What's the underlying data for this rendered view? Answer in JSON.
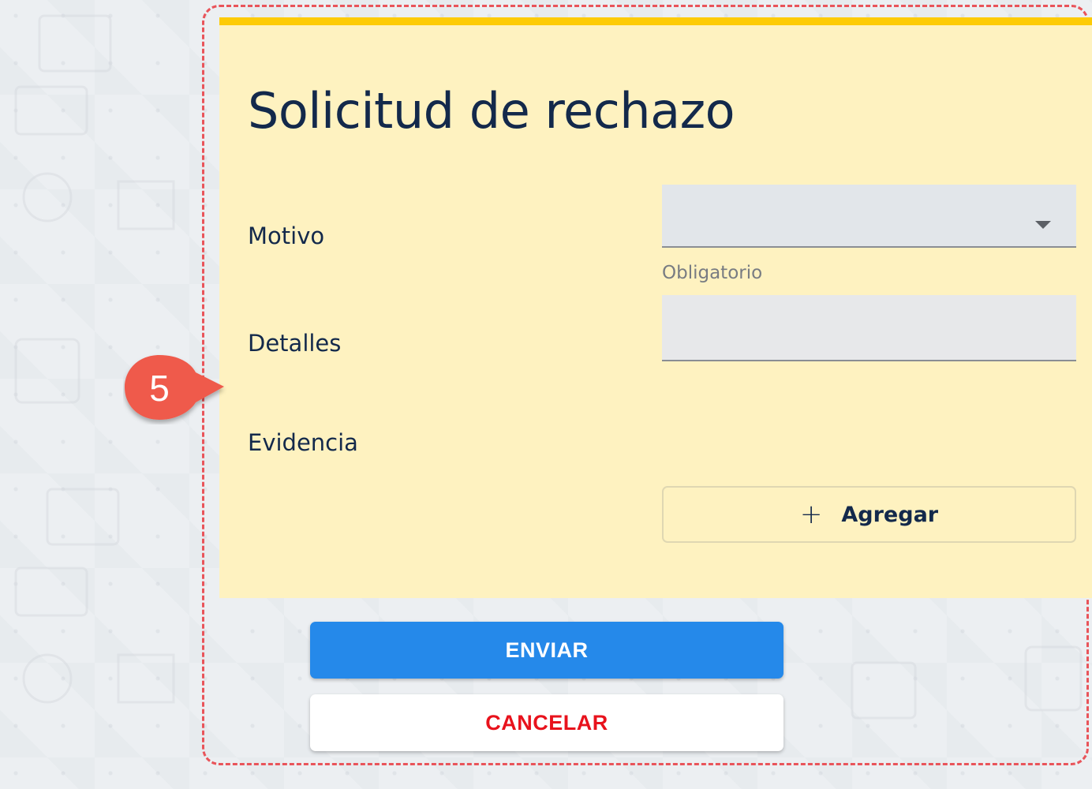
{
  "form": {
    "title": "Solicitud de rechazo",
    "fields": {
      "motivo": {
        "label": "Motivo",
        "value": "",
        "helper": "Obligatorio"
      },
      "detalles": {
        "label": "Detalles",
        "value": ""
      },
      "evidencia": {
        "label": "Evidencia",
        "add_label": "Agregar",
        "add_icon": "+"
      }
    }
  },
  "actions": {
    "send_label": "ENVIAR",
    "cancel_label": "CANCELAR"
  },
  "annotation": {
    "step_number": "5"
  },
  "colors": {
    "panel_bg": "#fef2c0",
    "panel_accent": "#fdcb06",
    "title_text": "#13294b",
    "send_button": "#2589ea",
    "cancel_text": "#e8121c",
    "annotation": "#ef5a4c",
    "frame_dash": "#e9545a"
  },
  "icons": {
    "select_caret": "chevron-down-icon",
    "add": "plus-icon"
  }
}
